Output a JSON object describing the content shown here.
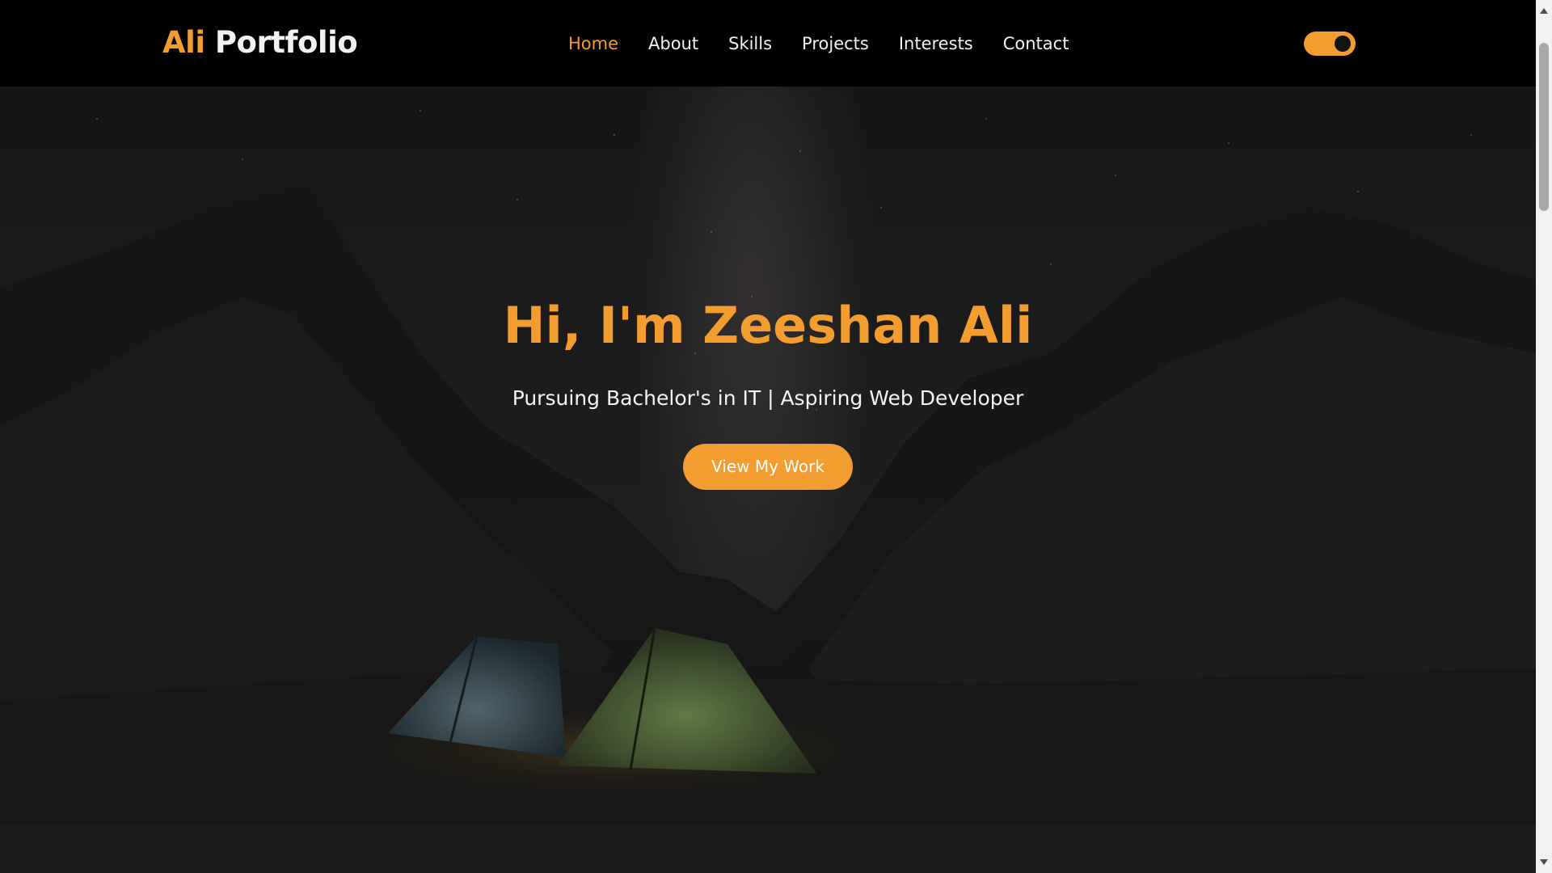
{
  "header": {
    "logo_accent": "Ali",
    "logo_rest": "Portfolio",
    "nav": [
      {
        "label": "Home",
        "active": true
      },
      {
        "label": "About",
        "active": false
      },
      {
        "label": "Skills",
        "active": false
      },
      {
        "label": "Projects",
        "active": false
      },
      {
        "label": "Interests",
        "active": false
      },
      {
        "label": "Contact",
        "active": false
      }
    ],
    "theme_toggle": {
      "state": "on",
      "icon": "toggle-switch-icon"
    }
  },
  "hero": {
    "title": "Hi, I'm Zeeshan Ali",
    "subtitle": "Pursuing Bachelor's in IT | Aspiring Web Developer",
    "button_label": "View My Work",
    "background_icon": "night-camping-mountains-image"
  },
  "colors": {
    "accent": "#f39c2f",
    "header_bg": "#000000",
    "text_light": "#f2f2f2"
  },
  "scrollbar": {
    "up_icon": "scroll-up-arrow-icon",
    "down_icon": "scroll-down-arrow-icon"
  }
}
